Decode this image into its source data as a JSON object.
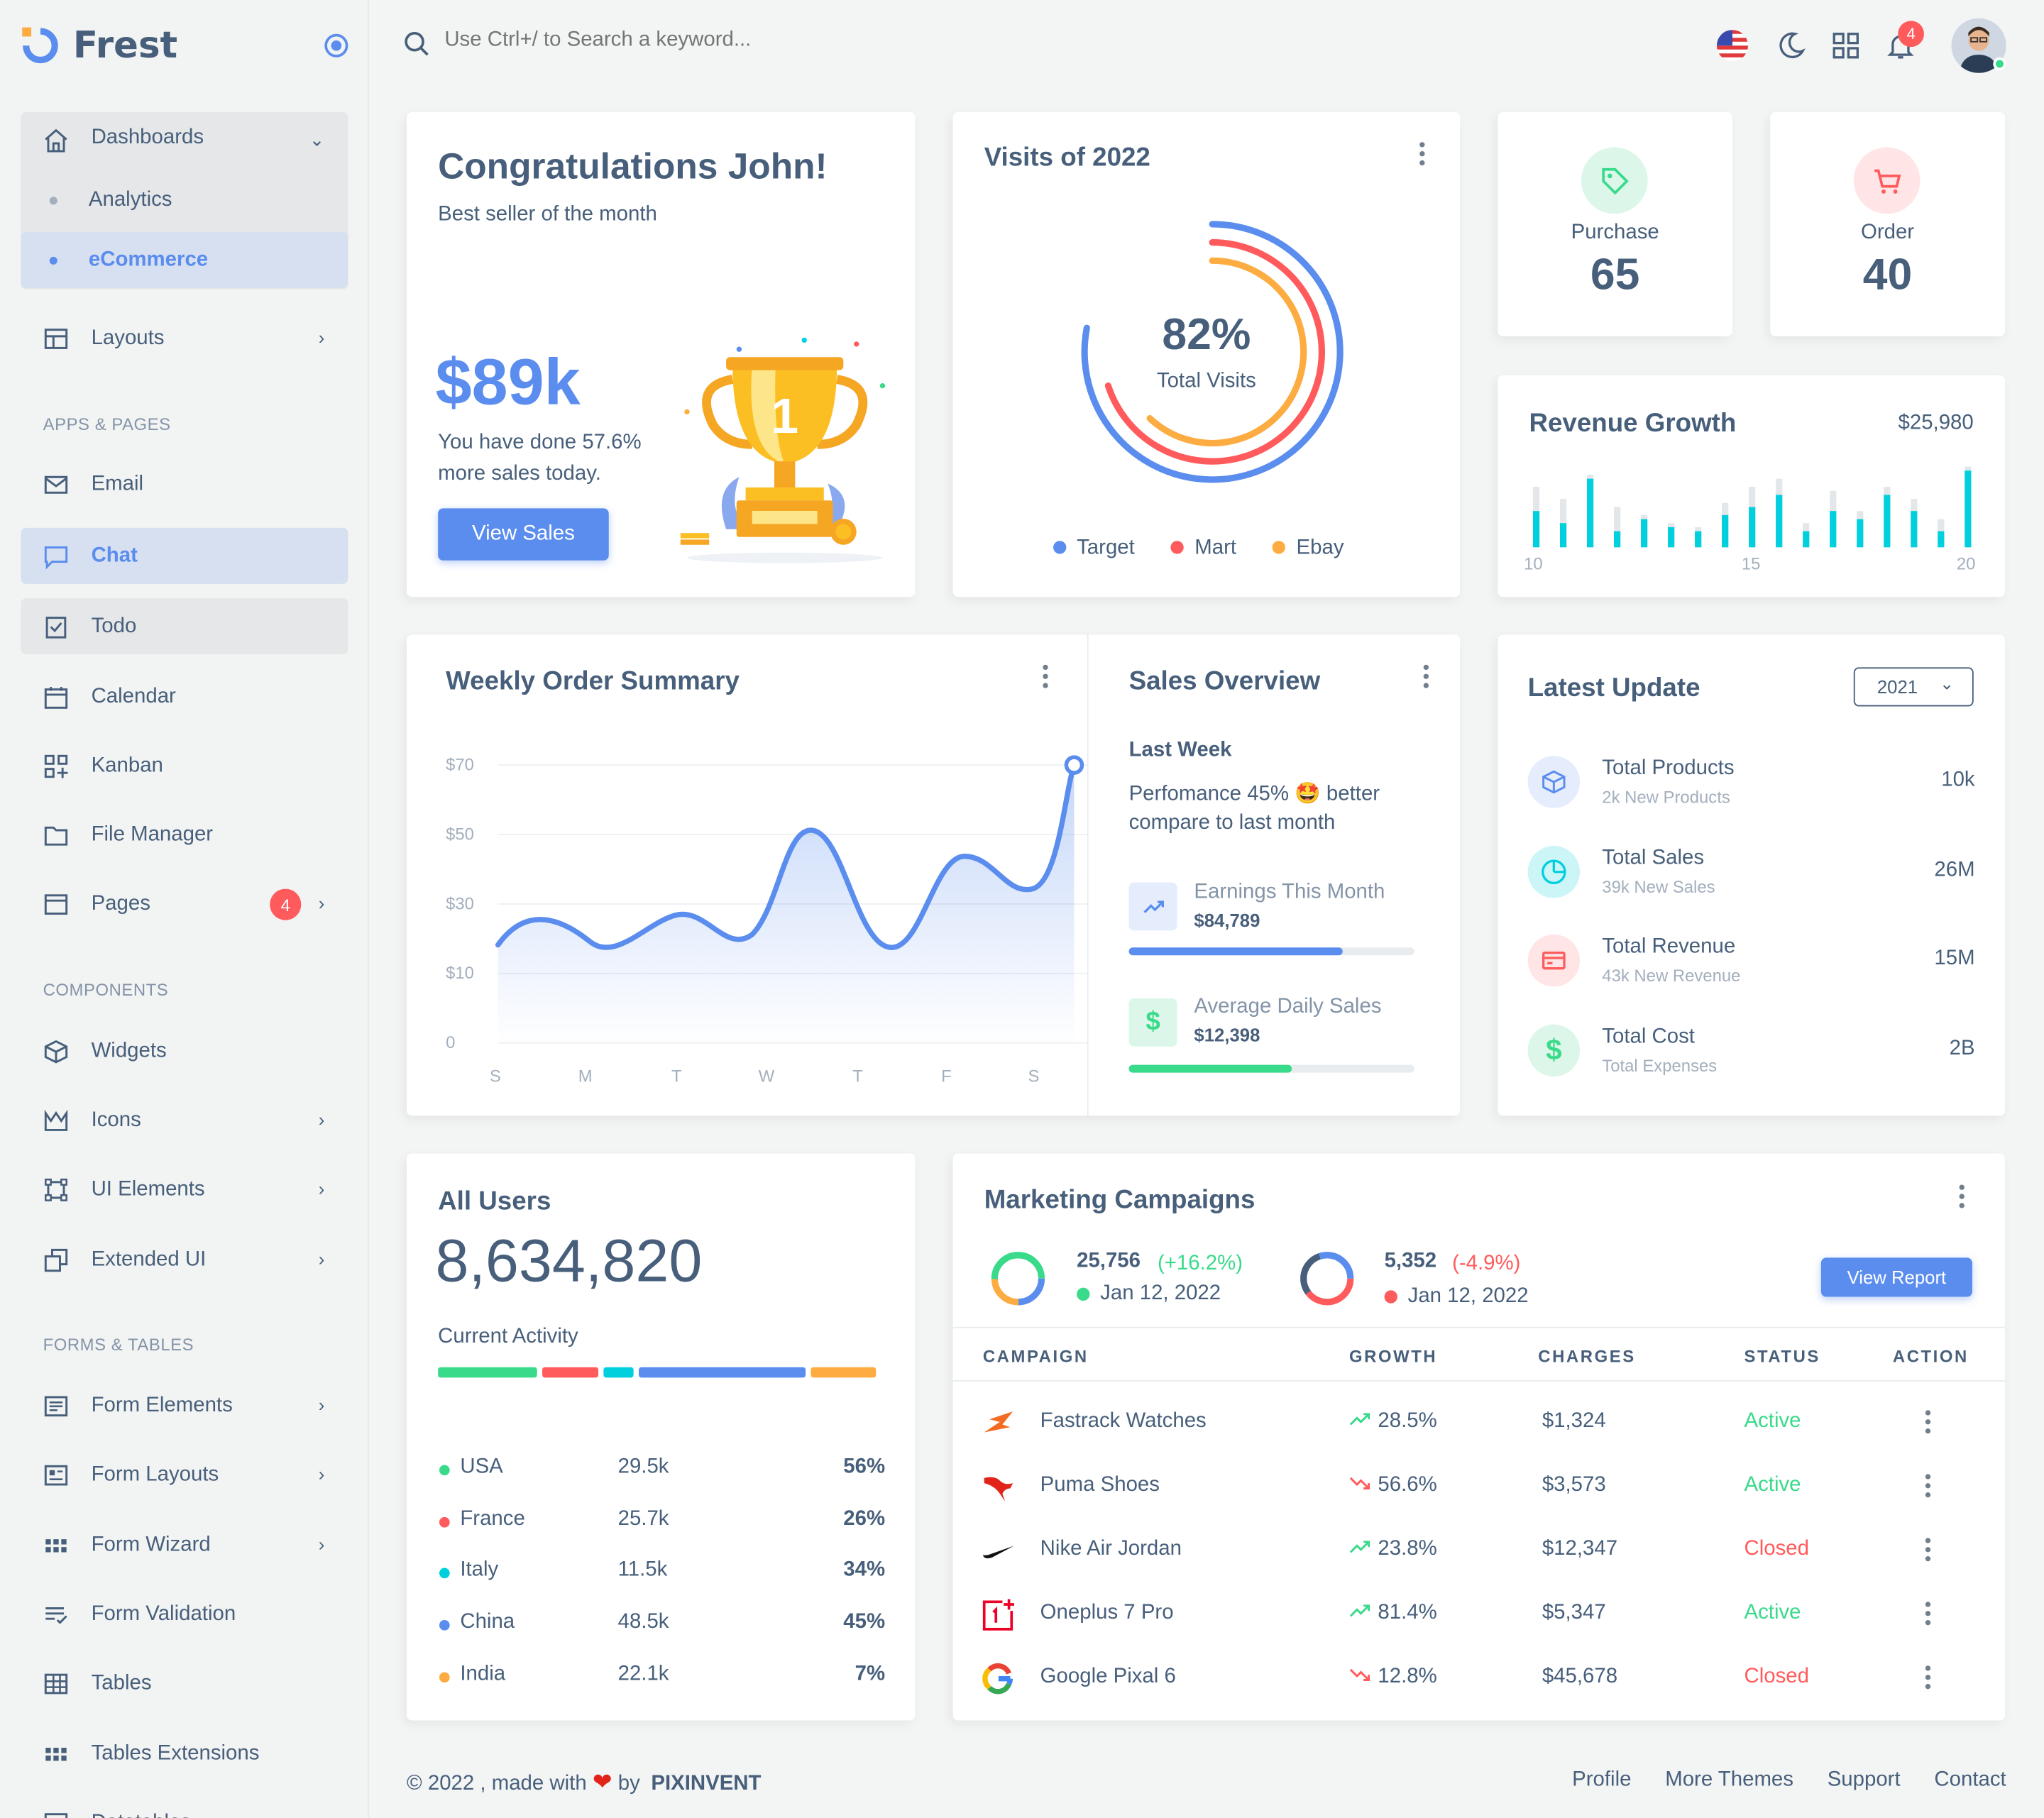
{
  "brand": {
    "name": "Frest"
  },
  "sidebar": {
    "dashboards": "Dashboards",
    "analytics": "Analytics",
    "ecommerce": "eCommerce",
    "layouts": "Layouts",
    "sec_apps": "APPS & PAGES",
    "email": "Email",
    "chat": "Chat",
    "todo": "Todo",
    "calendar": "Calendar",
    "kanban": "Kanban",
    "file_manager": "File Manager",
    "pages": "Pages",
    "pages_badge": "4",
    "sec_components": "COMPONENTS",
    "widgets": "Widgets",
    "icons": "Icons",
    "ui_elements": "UI Elements",
    "extended_ui": "Extended UI",
    "sec_forms": "FORMS & TABLES",
    "form_elements": "Form Elements",
    "form_layouts": "Form Layouts",
    "form_wizard": "Form Wizard",
    "form_validation": "Form Validation",
    "tables": "Tables",
    "tables_extensions": "Tables Extensions",
    "datatables": "Datatables"
  },
  "topbar": {
    "search_placeholder": "Use Ctrl+/ to Search a keyword...",
    "notif_count": "4"
  },
  "congrats": {
    "title": "Congratulations John!",
    "subtitle": "Best seller of the month",
    "amount": "$89k",
    "line1": "You have done 57.6%",
    "line2": "more sales today.",
    "button": "View Sales"
  },
  "visits": {
    "title": "Visits of 2022",
    "percent": "82%",
    "label": "Total Visits",
    "legend": [
      "Target",
      "Mart",
      "Ebay"
    ],
    "colors": [
      "#5a8dee",
      "#ff5b5c",
      "#fdac41"
    ]
  },
  "purchase": {
    "label": "Purchase",
    "value": "65"
  },
  "order": {
    "label": "Order",
    "value": "40"
  },
  "revenue": {
    "title": "Revenue Growth",
    "amount": "$25,980",
    "ticks": [
      "10",
      "15",
      "20"
    ]
  },
  "weekly": {
    "title": "Weekly Order Summary",
    "ylabels": [
      "$70",
      "$50",
      "$30",
      "$10",
      "0"
    ],
    "xlabels": [
      "S",
      "M",
      "T",
      "W",
      "T",
      "F",
      "S"
    ]
  },
  "sales_overview": {
    "title": "Sales Overview",
    "period": "Last Week",
    "text1": "Perfomance 45% 🤩 better",
    "text2": "compare to last month",
    "earn_label": "Earnings This Month",
    "earn_value": "$84,789",
    "earn_progress": 0.75,
    "avg_label": "Average Daily Sales",
    "avg_value": "$12,398",
    "avg_progress": 0.57
  },
  "latest": {
    "title": "Latest Update",
    "year": "2021",
    "items": [
      {
        "title": "Total Products",
        "sub": "2k New Products",
        "value": "10k"
      },
      {
        "title": "Total Sales",
        "sub": "39k New Sales",
        "value": "26M"
      },
      {
        "title": "Total Revenue",
        "sub": "43k New Revenue",
        "value": "15M"
      },
      {
        "title": "Total Cost",
        "sub": "Total Expenses",
        "value": "2B"
      }
    ]
  },
  "users": {
    "title": "All Users",
    "count": "8,634,820",
    "activity": "Current Activity",
    "rows": [
      {
        "country": "USA",
        "value": "29.5k",
        "pct": "56%",
        "color": "#39da8a"
      },
      {
        "country": "France",
        "value": "25.7k",
        "pct": "26%",
        "color": "#ff5b5c"
      },
      {
        "country": "Italy",
        "value": "11.5k",
        "pct": "34%",
        "color": "#00cfdd"
      },
      {
        "country": "China",
        "value": "48.5k",
        "pct": "45%",
        "color": "#5a8dee"
      },
      {
        "country": "India",
        "value": "22.1k",
        "pct": "7%",
        "color": "#fdac41"
      }
    ]
  },
  "marketing": {
    "title": "Marketing Campaigns",
    "stat1_value": "25,756",
    "stat1_change": "(+16.2%)",
    "stat1_date": "Jan 12, 2022",
    "stat2_value": "5,352",
    "stat2_change": "(-4.9%)",
    "stat2_date": "Jan 12, 2022",
    "button": "View Report",
    "headers": [
      "CAMPAIGN",
      "GROWTH",
      "CHARGES",
      "STATUS",
      "ACTION"
    ],
    "rows": [
      {
        "name": "Fastrack Watches",
        "growth": "28.5%",
        "charges": "$1,324",
        "status": "Active"
      },
      {
        "name": "Puma Shoes",
        "growth": "56.6%",
        "charges": "$3,573",
        "status": "Active"
      },
      {
        "name": "Nike Air Jordan",
        "growth": "23.8%",
        "charges": "$12,347",
        "status": "Closed"
      },
      {
        "name": "Oneplus 7 Pro",
        "growth": "81.4%",
        "charges": "$5,347",
        "status": "Active"
      },
      {
        "name": "Google Pixal 6",
        "growth": "12.8%",
        "charges": "$45,678",
        "status": "Closed"
      }
    ]
  },
  "footer": {
    "copy": "© 2022 , made with",
    "by": "by",
    "company": "PIXINVENT",
    "links": [
      "Profile",
      "More Themes",
      "Support",
      "Contact"
    ]
  }
}
